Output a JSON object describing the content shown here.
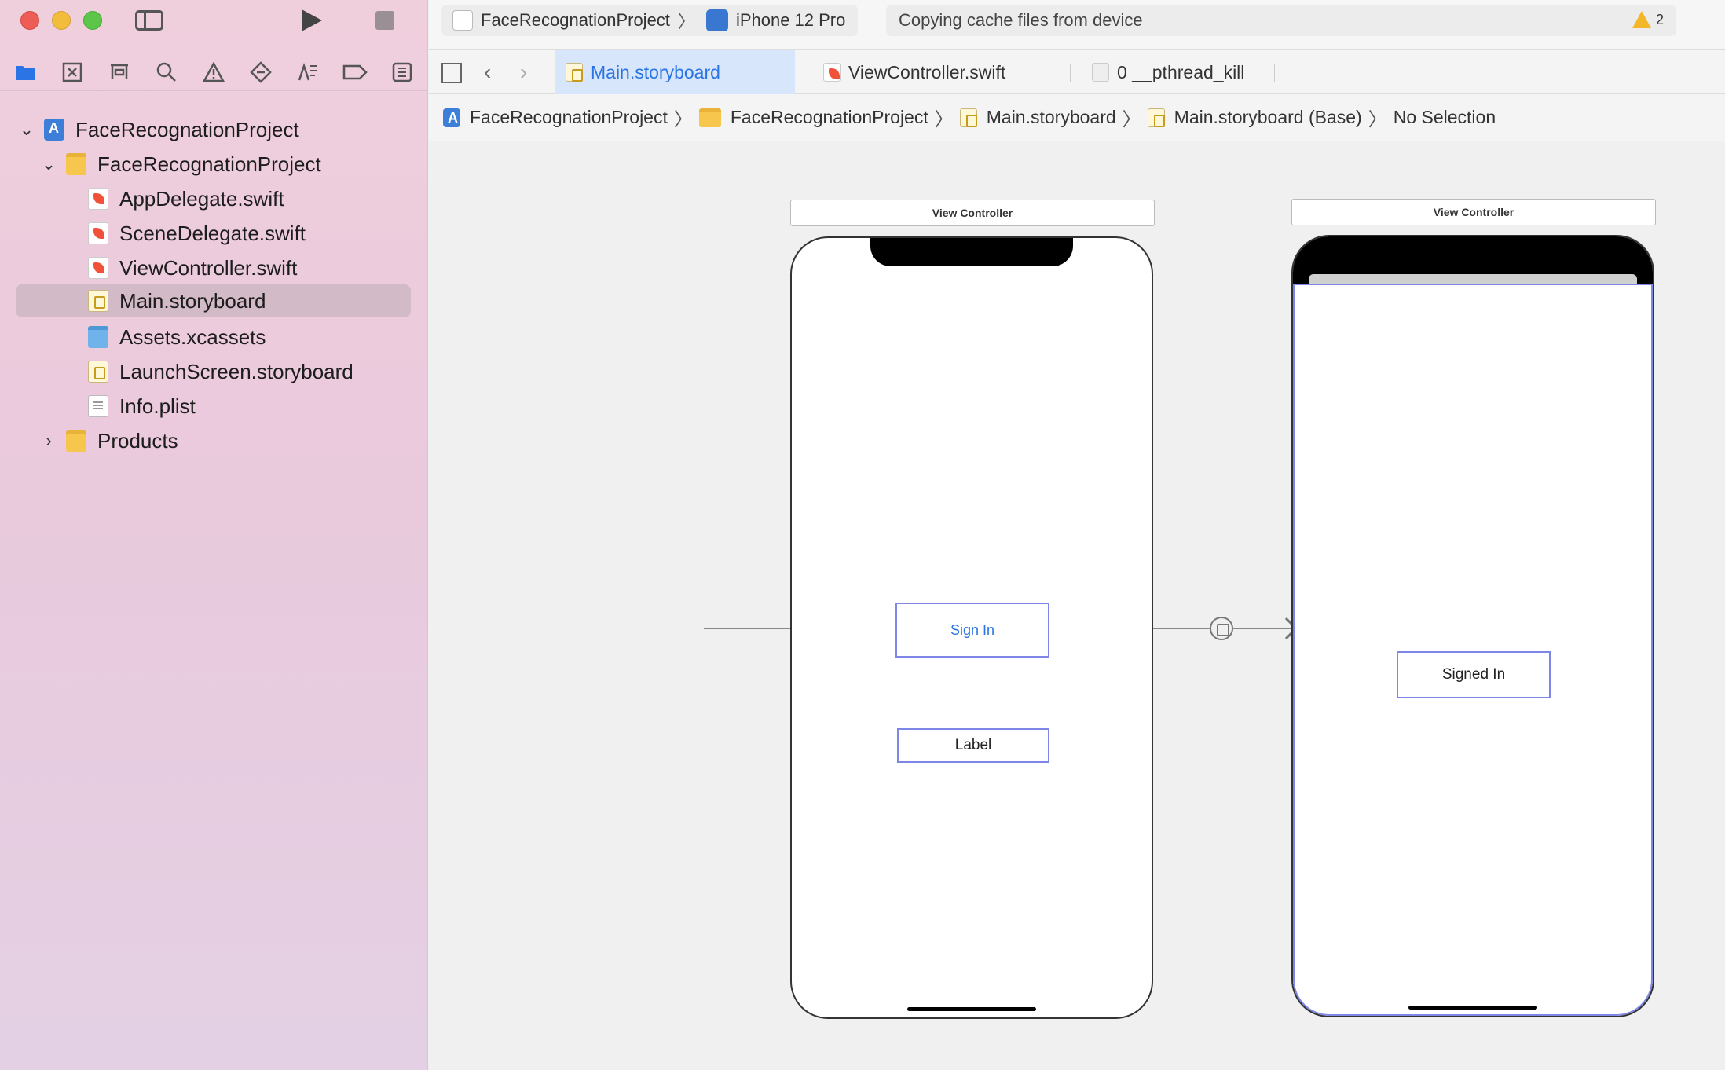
{
  "window": {
    "scheme": {
      "project": "FaceRecognationProject",
      "device": "iPhone 12 Pro"
    },
    "status": {
      "text": "Copying cache files from device",
      "warnings": "2"
    }
  },
  "sidebar": {
    "tree": [
      {
        "label": "FaceRecognationProject",
        "kind": "project",
        "expanded": true
      },
      {
        "label": "FaceRecognationProject",
        "kind": "folder",
        "expanded": true
      },
      {
        "label": "AppDelegate.swift",
        "kind": "swift"
      },
      {
        "label": "SceneDelegate.swift",
        "kind": "swift"
      },
      {
        "label": "ViewController.swift",
        "kind": "swift"
      },
      {
        "label": "Main.storyboard",
        "kind": "storyboard",
        "selected": true
      },
      {
        "label": "Assets.xcassets",
        "kind": "assets"
      },
      {
        "label": "LaunchScreen.storyboard",
        "kind": "storyboard"
      },
      {
        "label": "Info.plist",
        "kind": "plist"
      },
      {
        "label": "Products",
        "kind": "folder",
        "expanded": false
      }
    ]
  },
  "tabs": [
    {
      "label": "Main.storyboard",
      "active": true
    },
    {
      "label": "ViewController.swift",
      "active": false
    },
    {
      "label": "0 __pthread_kill",
      "active": false
    }
  ],
  "breadcrumb": [
    "FaceRecognationProject",
    "FaceRecognationProject",
    "Main.storyboard",
    "Main.storyboard (Base)",
    "No Selection"
  ],
  "canvas": {
    "scene1": {
      "title": "View Controller",
      "button": "Sign In",
      "label": "Label"
    },
    "scene2": {
      "title": "View Controller",
      "button": "Signed In"
    }
  },
  "colors": {
    "accent": "#2a74e5",
    "selection_outline": "#7e86e8",
    "sidebar_selected": "#d3bac7"
  }
}
